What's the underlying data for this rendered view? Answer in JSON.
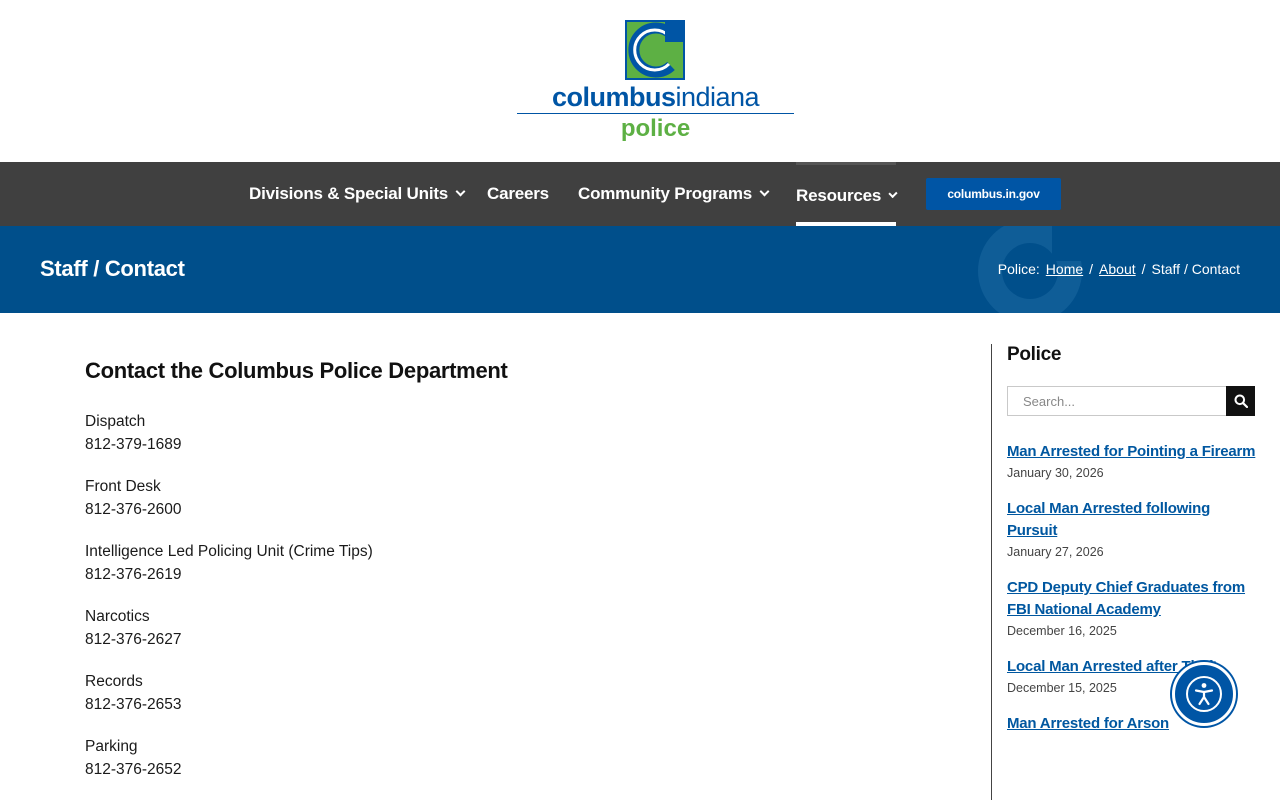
{
  "header": {
    "logo_word_bold": "columbus",
    "logo_word_light": "indiana",
    "logo_sub": "police"
  },
  "nav": {
    "items": [
      {
        "label": "Divisions & Special Units",
        "has_dropdown": true
      },
      {
        "label": "Careers",
        "has_dropdown": false
      },
      {
        "label": "Community Programs",
        "has_dropdown": true
      },
      {
        "label": "Resources",
        "has_dropdown": true,
        "active": true
      }
    ],
    "cta_label": "columbus.in.gov"
  },
  "title_band": {
    "title": "Staff / Contact",
    "breadcrumb": {
      "prefix": "Police:",
      "home": "Home",
      "sep1": "/",
      "about": "About",
      "sep2": "/",
      "current": "Staff / Contact"
    }
  },
  "main": {
    "heading": "Contact the Columbus Police Department",
    "contacts": [
      {
        "label": "Dispatch",
        "phone": "812-379-1689"
      },
      {
        "label": "Front Desk",
        "phone": "812-376-2600"
      },
      {
        "label": "Intelligence Led Policing Unit (Crime Tips)",
        "phone": "812-376-2619"
      },
      {
        "label": "Narcotics",
        "phone": "812-376-2627"
      },
      {
        "label": "Records",
        "phone": "812-376-2653"
      },
      {
        "label": "Parking",
        "phone": "812-376-2652"
      }
    ]
  },
  "sidebar": {
    "title": "Police",
    "search_placeholder": "Search...",
    "posts": [
      {
        "title": "Man Arrested for Pointing a Firearm",
        "date": "January 30, 2026"
      },
      {
        "title": "Local Man Arrested following Pursuit",
        "date": "January 27, 2026"
      },
      {
        "title": "CPD Deputy Chief Graduates from FBI National Academy",
        "date": "December 16, 2025"
      },
      {
        "title": "Local Man Arrested after Theft",
        "date": "December 15, 2025"
      },
      {
        "title": "Man Arrested for Arson",
        "date": ""
      }
    ]
  },
  "colors": {
    "brand_blue": "#0055a5",
    "brand_green": "#5db044",
    "nav_bg": "#404040",
    "title_band_bg": "#004f8b",
    "link": "#0057a0"
  },
  "icons": {
    "search": "search-icon",
    "accessibility": "accessibility-icon",
    "chevron": "chevron-down-icon"
  }
}
